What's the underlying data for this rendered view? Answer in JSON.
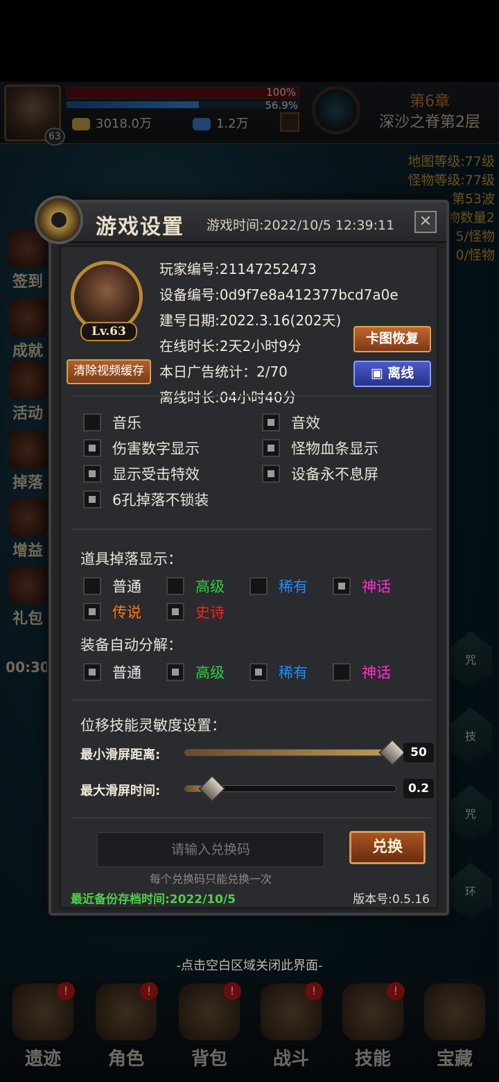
{
  "hud": {
    "hp_percent": "100%",
    "exp_percent": "56.9%",
    "exp_fraction": 0.569,
    "gold": "3018.0万",
    "gems": "1.2万",
    "player_level": "63",
    "chapter": "第6章",
    "stage": "深沙之脊第2层",
    "right_stats": [
      "地图等级:77级",
      "怪物等级:77级",
      "第53波",
      "物数量2",
      "5/怪物",
      "0/怪物"
    ]
  },
  "sidebar_left": [
    "签到",
    "成就",
    "活动",
    "掉落",
    "增益",
    "礼包"
  ],
  "sidebar_left_timer": "00:30",
  "sidebar_right": [
    "咒",
    "技",
    "咒",
    "环"
  ],
  "dialog": {
    "title": "游戏设置",
    "game_time": "游戏时间:2022/10/5 12:39:11",
    "close": "✕",
    "profile": {
      "level_badge": "Lv.63",
      "clear_cache_button": "清除视频缓存",
      "player_id": "玩家编号:21147252473",
      "device_id": "设备编号:0d9f7e8a412377bcd7a0e",
      "created": "建号日期:2022.3.16(202天)",
      "online": "在线时长:2天2小时9分",
      "ads": "本日广告统计：2/70",
      "offline_time": "离线时长:04小时40分",
      "repair_button": "卡图恢复",
      "offline_button": "离线"
    },
    "options": [
      {
        "label": "音乐",
        "checked": false
      },
      {
        "label": "音效",
        "checked": true
      },
      {
        "label": "伤害数字显示",
        "checked": true
      },
      {
        "label": "怪物血条显示",
        "checked": true
      },
      {
        "label": "显示受击特效",
        "checked": true
      },
      {
        "label": "设备永不息屏",
        "checked": true
      },
      {
        "label": "6孔掉落不锁装",
        "checked": true
      }
    ],
    "drop_display": {
      "title": "道具掉落显示：",
      "items": [
        {
          "label": "普通",
          "color": "#ecebe4",
          "checked": false
        },
        {
          "label": "高级",
          "color": "#2ed23a",
          "checked": false
        },
        {
          "label": "稀有",
          "color": "#1f8cff",
          "checked": false
        },
        {
          "label": "神话",
          "color": "#ff2fd6",
          "checked": true
        },
        {
          "label": "传说",
          "color": "#ff7a18",
          "checked": true
        },
        {
          "label": "史诗",
          "color": "#ff2020",
          "checked": true
        }
      ]
    },
    "auto_salvage": {
      "title": "装备自动分解：",
      "items": [
        {
          "label": "普通",
          "color": "#ecebe4",
          "checked": true
        },
        {
          "label": "高级",
          "color": "#2ed23a",
          "checked": true
        },
        {
          "label": "稀有",
          "color": "#1f8cff",
          "checked": true
        },
        {
          "label": "神话",
          "color": "#ff2fd6",
          "checked": false
        }
      ]
    },
    "sensitivity": {
      "title": "位移技能灵敏度设置：",
      "min_swipe_label": "最小滑屏距离:",
      "min_swipe_value": "50",
      "min_swipe_fraction": 0.98,
      "max_swipe_label": "最大滑屏时间:",
      "max_swipe_value": "0.2",
      "max_swipe_fraction": 0.13
    },
    "redeem": {
      "placeholder": "请输入兑换码",
      "button": "兑换",
      "note": "每个兑换码只能兑换一次"
    },
    "backup_time": "最近备份存档时间:2022/10/5",
    "version": "版本号:0.5.16"
  },
  "close_hint": "-点击空白区域关闭此界面-",
  "bottom_nav": [
    {
      "label": "遗迹",
      "alert": true
    },
    {
      "label": "角色",
      "alert": true
    },
    {
      "label": "背包",
      "alert": true
    },
    {
      "label": "战斗",
      "alert": true
    },
    {
      "label": "技能",
      "alert": true
    },
    {
      "label": "宝藏",
      "alert": false
    }
  ],
  "alert_mark": "!"
}
